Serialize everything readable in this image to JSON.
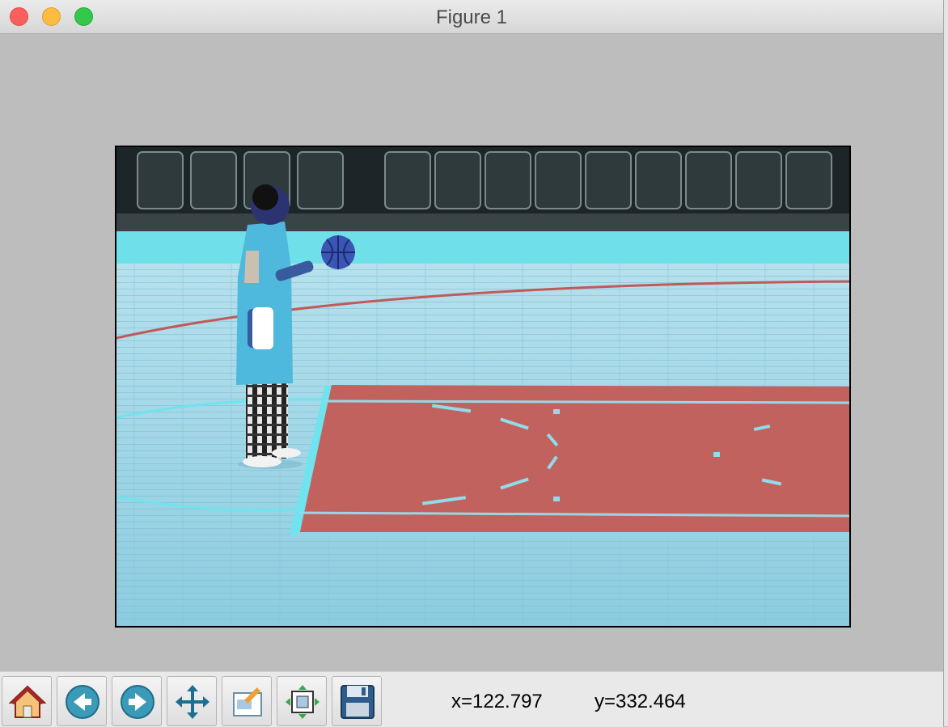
{
  "window": {
    "title": "Figure 1"
  },
  "toolbar": {
    "buttons": [
      {
        "name": "home-button",
        "icon": "home-icon"
      },
      {
        "name": "back-button",
        "icon": "back-arrow-icon"
      },
      {
        "name": "forward-button",
        "icon": "forward-arrow-icon"
      },
      {
        "name": "pan-button",
        "icon": "move-icon"
      },
      {
        "name": "zoom-button",
        "icon": "zoom-rect-icon"
      },
      {
        "name": "subplots-button",
        "icon": "subplots-icon"
      },
      {
        "name": "save-button",
        "icon": "floppy-disk-icon"
      }
    ],
    "x_readout": "x=122.797",
    "y_readout": "y=332.464"
  },
  "colors": {
    "figure_bg": "#bdbdbd",
    "court_floor": "#9fd6e6",
    "paint_red": "#c2625f",
    "court_line": "#6fe3ee"
  }
}
